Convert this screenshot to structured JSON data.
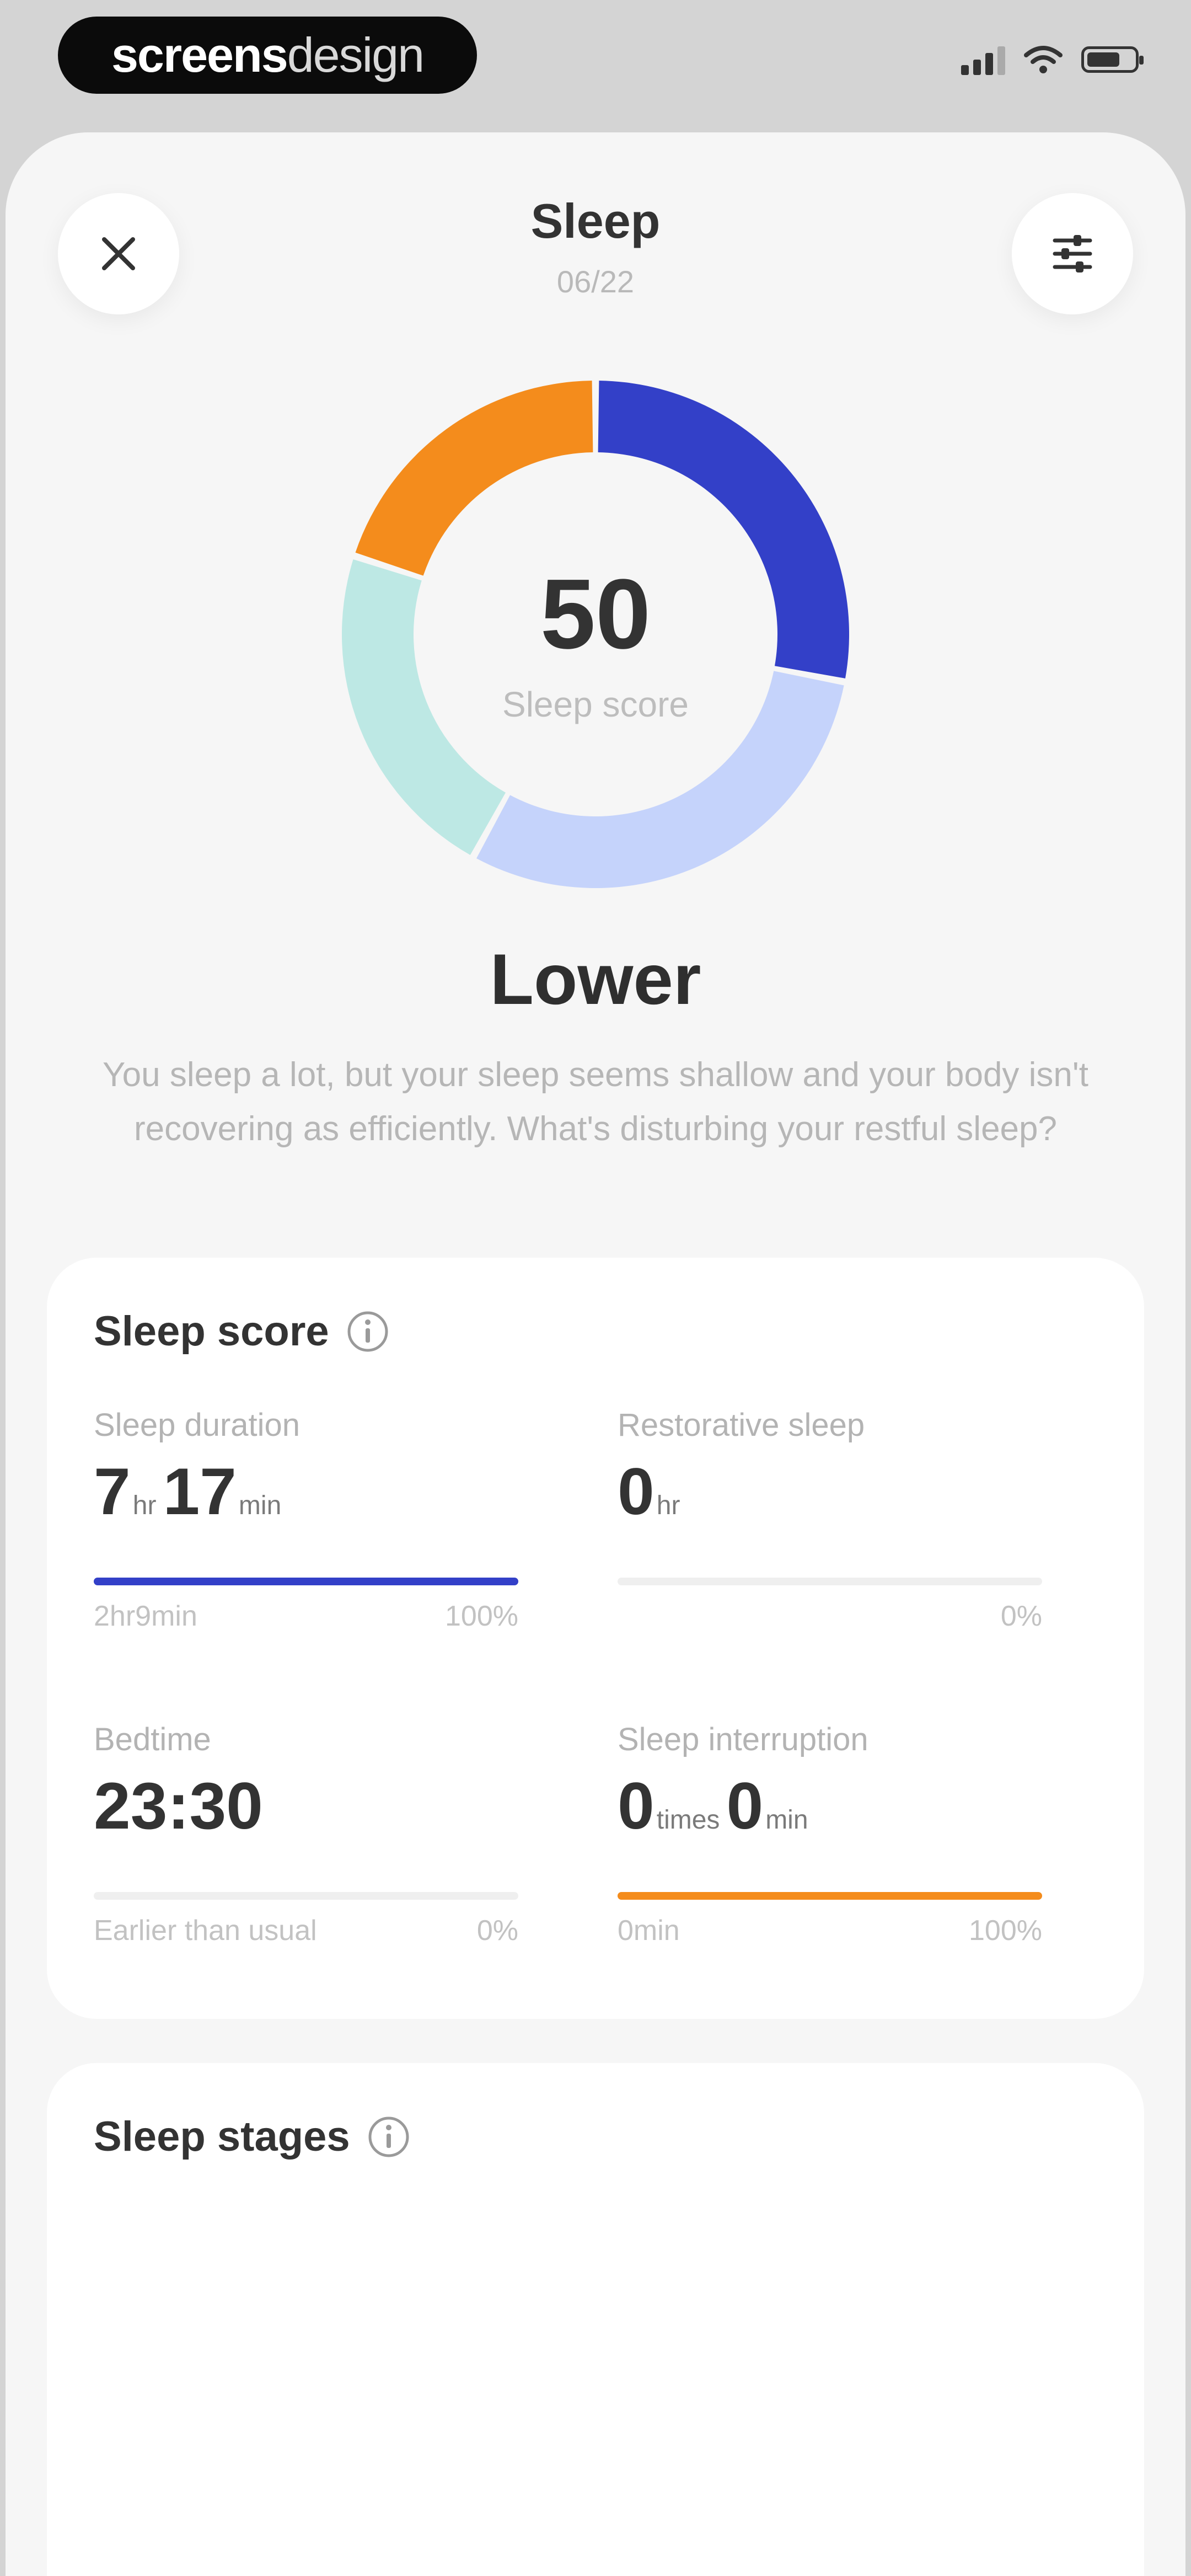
{
  "status_bar": {
    "brand_bold": "screens",
    "brand_light": "design"
  },
  "header": {
    "title": "Sleep",
    "date": "06/22",
    "close_icon": "close-icon",
    "filter_icon": "sliders-icon"
  },
  "summary": {
    "score": "50",
    "score_label": "Sleep score",
    "rating": "Lower",
    "description": "You sleep a lot, but your sleep seems shallow and your body isn't recovering as efficiently. What's disturbing your restful sleep?"
  },
  "chart_data": {
    "type": "pie",
    "donut": true,
    "slices": [
      {
        "value": 28,
        "color": "#3340c8"
      },
      {
        "value": 30,
        "color": "#c5d3fb"
      },
      {
        "value": 22,
        "color": "#bde8e4"
      },
      {
        "value": 20,
        "color": "#f48c1c"
      }
    ]
  },
  "score_card": {
    "title": "Sleep score",
    "metrics": [
      {
        "label": "Sleep duration",
        "v1": "7",
        "u1": "hr",
        "v2": "17",
        "u2": "min",
        "progress": 1.0,
        "bar_color": "#3340c8",
        "foot_left": "2hr9min",
        "foot_right": "100%"
      },
      {
        "label": "Restorative sleep",
        "v1": "0",
        "u1": "hr",
        "v2": "",
        "u2": "",
        "progress": 0.0,
        "bar_color": "#3340c8",
        "foot_left": "",
        "foot_right": "0%"
      },
      {
        "label": "Bedtime",
        "v1": "23:30",
        "u1": "",
        "v2": "",
        "u2": "",
        "progress": 0.0,
        "bar_color": "#3340c8",
        "foot_left": "Earlier than usual",
        "foot_right": "0%"
      },
      {
        "label": "Sleep interruption",
        "v1": "0",
        "u1": "times",
        "v2": "0",
        "u2": "min",
        "progress": 1.0,
        "bar_color": "#f48c1c",
        "foot_left": "0min",
        "foot_right": "100%"
      }
    ]
  },
  "stages_card": {
    "title": "Sleep stages"
  },
  "colors": {
    "accent_blue": "#3340c8",
    "accent_orange": "#f48c1c",
    "sheet_bg": "#f6f6f6"
  }
}
